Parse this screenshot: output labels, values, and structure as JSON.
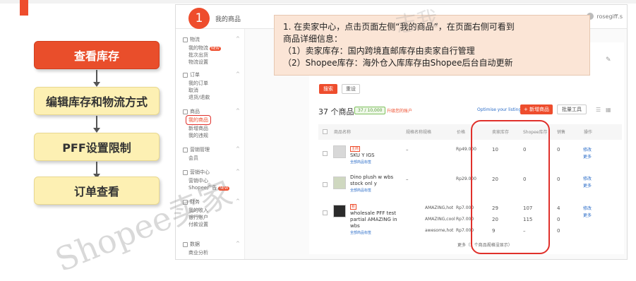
{
  "steps": [
    "查看库存",
    "编辑库存和物流方式",
    "PFF设置限制",
    "订单查看"
  ],
  "shot": {
    "step_number": "1",
    "breadcrumb": "我的商品",
    "username": "rosegiff.s"
  },
  "sidebar": {
    "sections": [
      {
        "title": "物流",
        "items": [
          "我的物流",
          "批次出货",
          "物流设置"
        ]
      },
      {
        "title": "订单",
        "items": [
          "我的订单",
          "取消",
          "退货/退款"
        ]
      },
      {
        "title": "商品",
        "items": [
          "我的商品",
          "新增商品",
          "我的违规"
        ]
      },
      {
        "title": "营销管理",
        "items": [
          "会员"
        ]
      },
      {
        "title": "营销中心",
        "items": [
          "营销中心",
          "Shopee广告"
        ]
      },
      {
        "title": "财务",
        "items": [
          "我的收入",
          "银行账户",
          "付款设置"
        ]
      },
      {
        "title": "数据",
        "items": [
          "商业分析"
        ]
      }
    ],
    "new_badge": "NEW"
  },
  "filters": {
    "search_btn": "搜索",
    "reset_btn": "重设"
  },
  "products_count": "37 个商品",
  "quota": "37 / 10,000",
  "quota_link": "升级您的账户",
  "optimise": "Optimise your listing",
  "add_btn": "+ 新增商品",
  "batch_btn": "批量工具",
  "columns": [
    "商品名称",
    "规格名称",
    "规格",
    "价格",
    "卖家库存",
    "Shopee库存",
    "销售",
    "操作"
  ],
  "rows": [
    {
      "tag": "主商",
      "name": "SKU Y IGS",
      "sub": "全部商品标签",
      "variation": "–",
      "price": "Rp49.000",
      "seller": "10",
      "shopee": "0",
      "sales": "0",
      "act1": "修改",
      "act2": "更多"
    },
    {
      "tag": "",
      "name": "Dino plush w wbs stock onl y",
      "sub": "全部商品标签",
      "variation": "–",
      "price": "Rp29.000",
      "seller": "20",
      "shopee": "0",
      "sales": "0",
      "act1": "修改",
      "act2": "更多"
    },
    {
      "tag": "新",
      "name": "wholesale PFF test partial AMAZING in wbs",
      "sub": "全部商品标签",
      "variations": [
        {
          "v": "AMAZING,hot",
          "p": "Rp7.000",
          "s": "29",
          "sh": "107",
          "sa": "4"
        },
        {
          "v": "AMAZING,cool",
          "p": "Rp7.000",
          "s": "20",
          "sh": "115",
          "sa": "0"
        },
        {
          "v": "awesome,hot",
          "p": "Rp7.000",
          "s": "9",
          "sh": "–",
          "sa": "0"
        }
      ],
      "act1": "修改",
      "act2": "更多"
    }
  ],
  "more_link": "更多（1 个商品规格没显示）",
  "callout": {
    "line1": "1. 在卖家中心，点击页面左侧“我的商品”，在页面右侧可看到",
    "line2": "商品详细信息：",
    "line3": "（1）卖家库存：国内跨境直邮库存由卖家自行管理",
    "line4": "（2）Shopee库存：海外仓入库库存由Shopee后台自动更新"
  },
  "watermark": "Shopee卖家",
  "watermark2": "志我"
}
